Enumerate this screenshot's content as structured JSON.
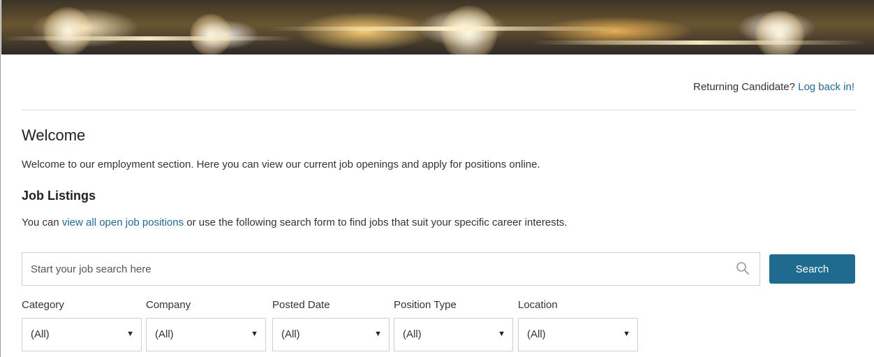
{
  "header": {
    "returning_text": "Returning Candidate?",
    "login_link": "Log back in!"
  },
  "welcome": {
    "title": "Welcome",
    "text": "Welcome to our employment section. Here you can view our current job openings and apply for positions online."
  },
  "listings": {
    "title": "Job Listings",
    "text_before": "You can ",
    "link": "view all open job positions",
    "text_after": " or use the following search form to find jobs that suit your specific career interests."
  },
  "search": {
    "placeholder": "Start your job search here",
    "value": "",
    "button_label": "Search",
    "icon": "search-icon"
  },
  "filters": [
    {
      "label": "Category",
      "value": "(All)"
    },
    {
      "label": "Company",
      "value": "(All)"
    },
    {
      "label": "Posted Date",
      "value": "(All)"
    },
    {
      "label": "Position Type",
      "value": "(All)"
    },
    {
      "label": "Location",
      "value": "(All)"
    }
  ],
  "colors": {
    "accent": "#1f6a8f",
    "text": "#333333",
    "border": "#cfcfcf"
  }
}
